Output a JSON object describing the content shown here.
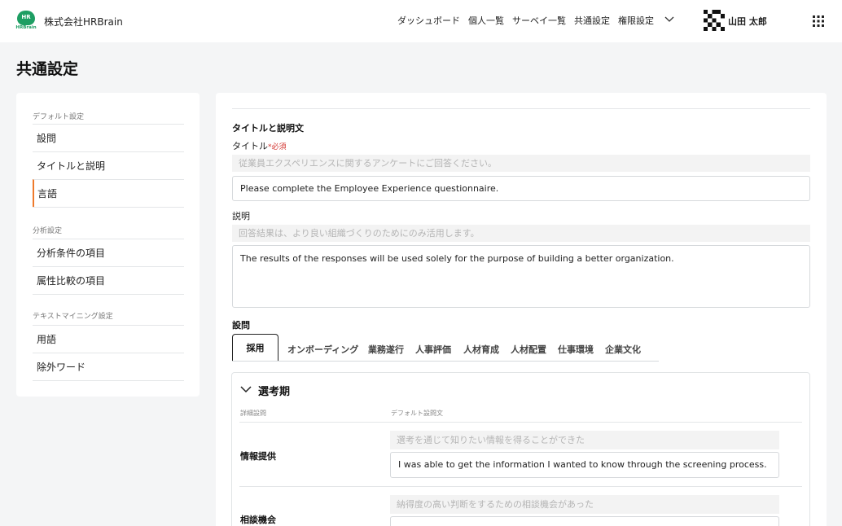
{
  "header": {
    "logo_text": "HR",
    "logo_sub": "HRBrain",
    "company": "株式会社HRBrain",
    "nav": [
      "ダッシュボード",
      "個人一覧",
      "サーベイ一覧",
      "共通設定",
      "権限設定"
    ],
    "user_name": "山田 太郎"
  },
  "page": {
    "title": "共通設定"
  },
  "sidebar": {
    "sections": [
      {
        "title": "デフォルト設定",
        "items": [
          "設問",
          "タイトルと説明",
          "言語"
        ]
      },
      {
        "title": "分析設定",
        "items": [
          "分析条件の項目",
          "属性比較の項目"
        ]
      },
      {
        "title": "テキストマイニング設定",
        "items": [
          "用語",
          "除外ワード"
        ]
      }
    ],
    "active_item": "言語"
  },
  "main": {
    "section_title": "タイトルと説明文",
    "title_label": "タイトル",
    "required": "必須",
    "title_default": "従業員エクスペリエンスに関するアンケートにご回答ください。",
    "title_value": "Please complete the Employee Experience questionnaire.",
    "desc_label": "説明",
    "desc_default": "回答結果は、より良い組織づくりのためにのみ活用します。",
    "desc_value": "The results of the responses will be used solely for the purpose of building a better organization.",
    "questions_label": "設問",
    "tabs": [
      "採用",
      "オンボーディング",
      "業務遂行",
      "人事評価",
      "人材育成",
      "人材配置",
      "仕事環境",
      "企業文化"
    ],
    "card": {
      "title": "選考期",
      "col_detail": "詳細設問",
      "col_default": "デフォルト設問文",
      "rows": [
        {
          "label": "情報提供",
          "default": "選考を通じて知りたい情報を得ることができた",
          "value": "I was able to get the information I wanted to know through the screening process."
        },
        {
          "label": "相談機会",
          "default": "納得度の高い判断をするための相談機会があった",
          "value": ""
        }
      ]
    }
  }
}
